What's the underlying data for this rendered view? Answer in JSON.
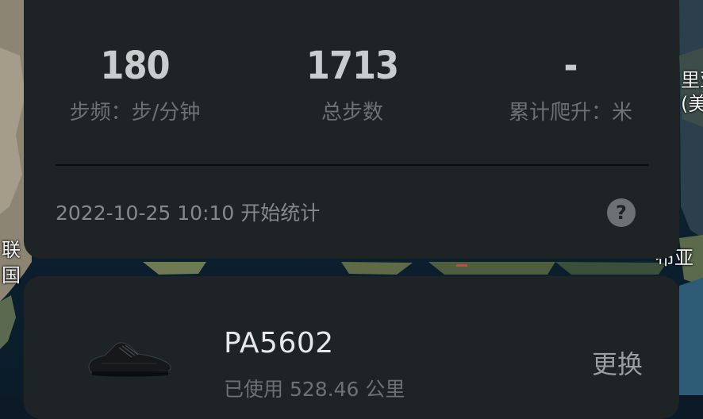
{
  "map": {
    "labels": [
      "里亚",
      "(美",
      "联",
      "国",
      "布亚"
    ]
  },
  "stats": [
    {
      "value": "180",
      "label": "步频：步/分钟"
    },
    {
      "value": "1713",
      "label": "总步数"
    },
    {
      "value": "-",
      "label": "累计爬升：米"
    }
  ],
  "start": {
    "datetime": "2022-10-25 10:10",
    "text": "开始统计"
  },
  "help": {
    "icon": "help-icon",
    "glyph": "?"
  },
  "shoe": {
    "icon": "shoe-icon",
    "name": "PA5602",
    "distance": "已使用 528.46 公里",
    "change_label": "更换"
  },
  "colors": {
    "card": "#1e2426",
    "value_text": "#c9cccd",
    "label_text": "#6c7174"
  }
}
